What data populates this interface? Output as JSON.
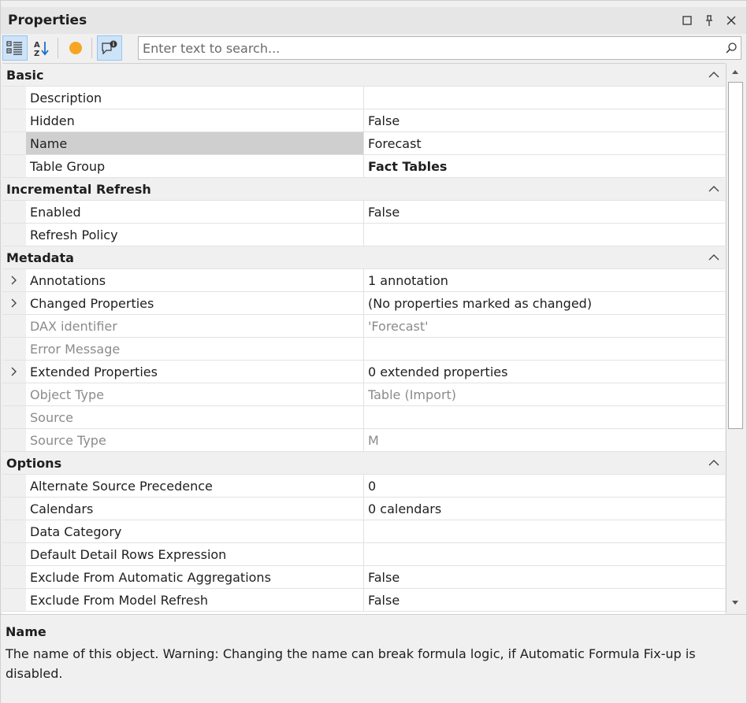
{
  "window": {
    "title": "Properties"
  },
  "search": {
    "placeholder": "Enter text to search..."
  },
  "categories": [
    {
      "title": "Basic",
      "rows": [
        {
          "name": "Description",
          "value": "",
          "expandable": false,
          "readonly": false,
          "selected": false,
          "bold": false
        },
        {
          "name": "Hidden",
          "value": "False",
          "expandable": false,
          "readonly": false,
          "selected": false,
          "bold": false
        },
        {
          "name": "Name",
          "value": "Forecast",
          "expandable": false,
          "readonly": false,
          "selected": true,
          "bold": false
        },
        {
          "name": "Table Group",
          "value": "Fact Tables",
          "expandable": false,
          "readonly": false,
          "selected": false,
          "bold": true
        }
      ]
    },
    {
      "title": "Incremental Refresh",
      "rows": [
        {
          "name": "Enabled",
          "value": "False",
          "expandable": false,
          "readonly": false,
          "selected": false,
          "bold": false
        },
        {
          "name": "Refresh Policy",
          "value": "",
          "expandable": false,
          "readonly": false,
          "selected": false,
          "bold": false
        }
      ]
    },
    {
      "title": "Metadata",
      "rows": [
        {
          "name": "Annotations",
          "value": "1 annotation",
          "expandable": true,
          "readonly": false,
          "selected": false,
          "bold": false
        },
        {
          "name": "Changed Properties",
          "value": "(No properties marked as changed)",
          "expandable": true,
          "readonly": false,
          "selected": false,
          "bold": false
        },
        {
          "name": "DAX identifier",
          "value": "'Forecast'",
          "expandable": false,
          "readonly": true,
          "selected": false,
          "bold": false
        },
        {
          "name": "Error Message",
          "value": "",
          "expandable": false,
          "readonly": true,
          "selected": false,
          "bold": false
        },
        {
          "name": "Extended Properties",
          "value": "0 extended properties",
          "expandable": true,
          "readonly": false,
          "selected": false,
          "bold": false
        },
        {
          "name": "Object Type",
          "value": "Table (Import)",
          "expandable": false,
          "readonly": true,
          "selected": false,
          "bold": false
        },
        {
          "name": "Source",
          "value": "",
          "expandable": false,
          "readonly": true,
          "selected": false,
          "bold": false
        },
        {
          "name": "Source Type",
          "value": "M",
          "expandable": false,
          "readonly": true,
          "selected": false,
          "bold": false
        }
      ]
    },
    {
      "title": "Options",
      "rows": [
        {
          "name": "Alternate Source Precedence",
          "value": "0",
          "expandable": false,
          "readonly": false,
          "selected": false,
          "bold": false
        },
        {
          "name": "Calendars",
          "value": "0 calendars",
          "expandable": false,
          "readonly": false,
          "selected": false,
          "bold": false
        },
        {
          "name": "Data Category",
          "value": "",
          "expandable": false,
          "readonly": false,
          "selected": false,
          "bold": false
        },
        {
          "name": "Default Detail Rows Expression",
          "value": "",
          "expandable": false,
          "readonly": false,
          "selected": false,
          "bold": false
        },
        {
          "name": "Exclude From Automatic Aggregations",
          "value": "False",
          "expandable": false,
          "readonly": false,
          "selected": false,
          "bold": false
        },
        {
          "name": "Exclude From Model Refresh",
          "value": "False",
          "expandable": false,
          "readonly": false,
          "selected": false,
          "bold": false
        }
      ]
    }
  ],
  "description": {
    "title": "Name",
    "text": "The name of this object. Warning: Changing the name can break formula logic, if Automatic Formula Fix-up is disabled."
  },
  "colors": {
    "accent": "#cde3f8",
    "selected_row": "#cfcfcf",
    "readonly_text": "#8b8b8b",
    "orange_dot": "#f5a623"
  }
}
